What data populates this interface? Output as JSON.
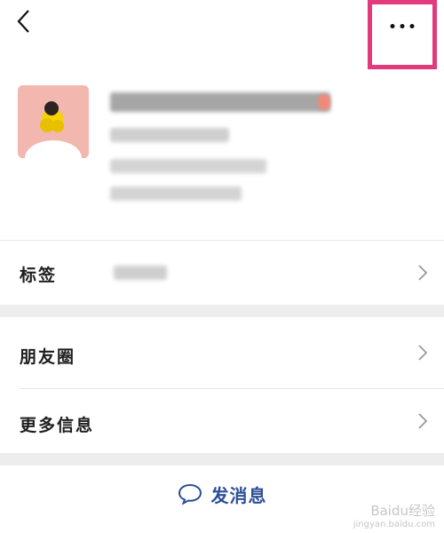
{
  "topbar": {
    "back_icon": "chevron-left-icon",
    "more_icon": "more-dots-icon",
    "highlight_color": "#e23a7c"
  },
  "rows": [
    {
      "label": "标签"
    },
    {
      "label": "朋友圈"
    },
    {
      "label": "更多信息"
    }
  ],
  "action": {
    "label": "发消息",
    "icon": "chat-bubble-icon",
    "color": "#2b4f96"
  },
  "watermark": {
    "brand": "Baidu经验",
    "url": "jingyan.baidu.com"
  }
}
